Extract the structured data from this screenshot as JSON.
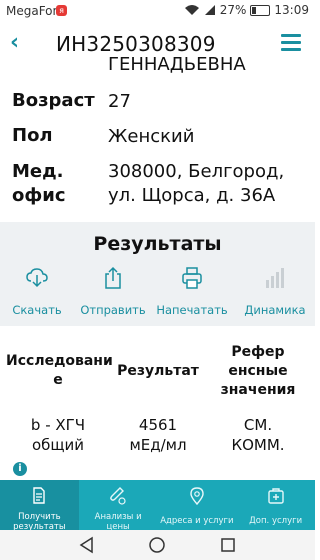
{
  "status": {
    "carrier": "MegaFon",
    "carrier_badge": "я",
    "battery": "27%",
    "time": "13:09"
  },
  "header": {
    "title": "ИН3250308309"
  },
  "patient": {
    "name_tail": "ГЕННАДЬЕВНА",
    "rows": [
      {
        "label": "Возраст",
        "value": "27"
      },
      {
        "label": "Пол",
        "value": "Женский"
      },
      {
        "label_line1": "Мед.",
        "label_line2": "офис",
        "value_line1": "308000, Белгород,",
        "value_line2": "ул. Щорса, д. 36А"
      }
    ]
  },
  "results": {
    "title": "Результаты",
    "actions": [
      {
        "label": "Скачать",
        "icon": "cloud-download-icon"
      },
      {
        "label": "Отправить",
        "icon": "share-icon"
      },
      {
        "label": "Напечатать",
        "icon": "print-icon"
      },
      {
        "label": "Динамика",
        "icon": "bar-chart-icon"
      }
    ]
  },
  "table": {
    "headers": {
      "study_l1": "Исследовани",
      "study_l2": "е",
      "result": "Результат",
      "ref_l1": "Рефер",
      "ref_l2": "енсные",
      "ref_l3": "значения"
    },
    "rows": [
      {
        "study_l1": "b - ХГЧ",
        "study_l2": "общий",
        "result_l1": "4561",
        "result_l2": "мЕд/мл",
        "ref_l1": "СМ.",
        "ref_l2": "КОММ."
      }
    ]
  },
  "bottom_nav": {
    "tabs": [
      {
        "line1": "Получить",
        "line2": "результаты",
        "icon": "document-icon"
      },
      {
        "line1": "Анализы и",
        "line2": "цены",
        "icon": "tube-icon"
      },
      {
        "line1": "Адреса и услуги",
        "line2": "",
        "icon": "location-icon"
      },
      {
        "line1": "Доп. услуги",
        "line2": "",
        "icon": "medkit-icon"
      }
    ]
  }
}
